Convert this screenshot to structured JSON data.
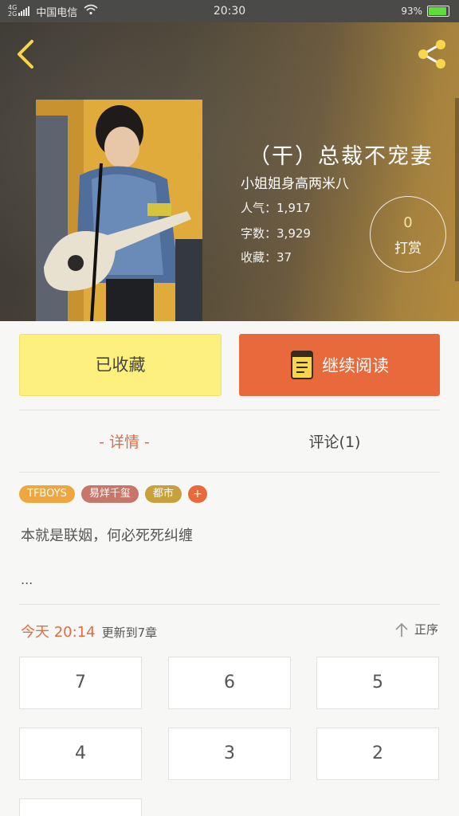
{
  "status_bar": {
    "network": "4G\n2G",
    "carrier": "中国电信",
    "time": "20:30",
    "battery": "93%",
    "battery_level": 0.93
  },
  "book": {
    "title": "（干）总裁不宠妻",
    "author": "小姐姐身高两米八",
    "popularity_label": "人气：",
    "popularity": "1,917",
    "word_count_label": "字数：",
    "word_count": "3,929",
    "favorites_label": "收藏：",
    "favorites": "37",
    "reward_count": "0",
    "reward_label": "打赏"
  },
  "actions": {
    "favorited_label": "已收藏",
    "continue_label": "继续阅读"
  },
  "tabs": {
    "detail_label": "- 详情 -",
    "comments_label": "评论(1)"
  },
  "tags": [
    {
      "label": "TFBOYS",
      "color": "#f0a640"
    },
    {
      "label": "易烊千玺",
      "color": "#c7766a"
    },
    {
      "label": "都市",
      "color": "#c8a03c"
    }
  ],
  "tag_add": "+",
  "tag_add_color": "#e8693b",
  "description": "本就是联姻，何必死死纠缠",
  "description_more": "...",
  "update": {
    "when": "今天 20:14",
    "info": "更新到7章",
    "sort_label": "正序"
  },
  "chapters": [
    "7",
    "6",
    "5",
    "4",
    "3",
    "2",
    ""
  ],
  "colors": {
    "accent": "#e8693b",
    "favorite_button": "#fdf07e"
  }
}
